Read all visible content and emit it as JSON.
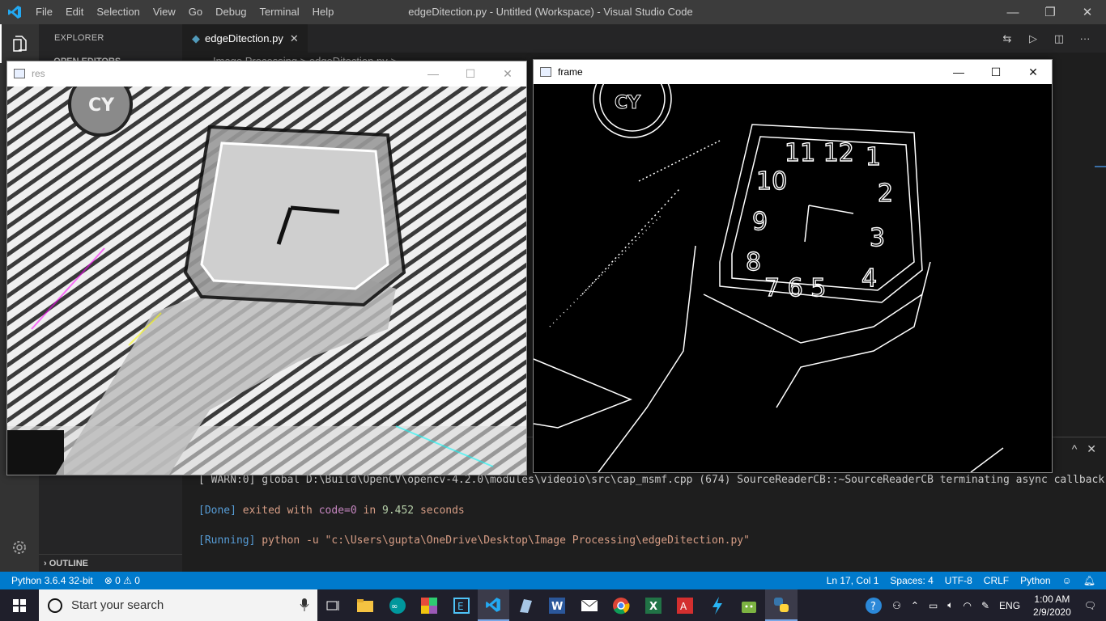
{
  "titlebar": {
    "menu": [
      "File",
      "Edit",
      "Selection",
      "View",
      "Go",
      "Debug",
      "Terminal",
      "Help"
    ],
    "window_title": "edgeDitection.py - Untitled (Workspace) - Visual Studio Code",
    "controls": {
      "minimize": "—",
      "restore": "❐",
      "close": "✕"
    }
  },
  "sidebar": {
    "title": "EXPLORER",
    "open_editors": "OPEN EDITORS",
    "outline": "OUTLINE"
  },
  "editor": {
    "tab_label": "edgeDitection.py",
    "tab_close": "✕",
    "breadcrumb": "Image Processing > edgeDitection.py >"
  },
  "panel": {
    "lines": {
      "warn": "[ WARN:0] global D:\\Build\\OpenCV\\opencv-4.2.0\\modules\\videoio\\src\\cap_msmf.cpp (674) SourceReaderCB::~SourceReaderCB terminating async callback",
      "done_tag": "[Done]",
      "done_text1": " exited with ",
      "done_code": "code=0",
      "done_text2": " in ",
      "done_time": "9.452",
      "done_text3": " seconds",
      "run_tag": "[Running]",
      "run_text": " python -u ",
      "run_path": "\"c:\\Users\\gupta\\OneDrive\\Desktop\\Image Processing\\edgeDitection.py\""
    },
    "controls": {
      "maximize": "^",
      "close": "✕"
    }
  },
  "statusbar": {
    "python": "Python 3.6.4 32-bit",
    "problems": "⊗ 0 ⚠ 0",
    "position": "Ln 17, Col 1",
    "spaces": "Spaces: 4",
    "encoding": "UTF-8",
    "eol": "CRLF",
    "language": "Python"
  },
  "cv_windows": {
    "res": {
      "title": "res"
    },
    "frame": {
      "title": "frame"
    }
  },
  "taskbar": {
    "search_placeholder": "Start your search",
    "lang": "ENG",
    "time": "1:00 AM",
    "date": "2/9/2020"
  },
  "colors": {
    "accent": "#007acc",
    "editor_bg": "#1e1e1e",
    "sidebar_bg": "#252526"
  }
}
